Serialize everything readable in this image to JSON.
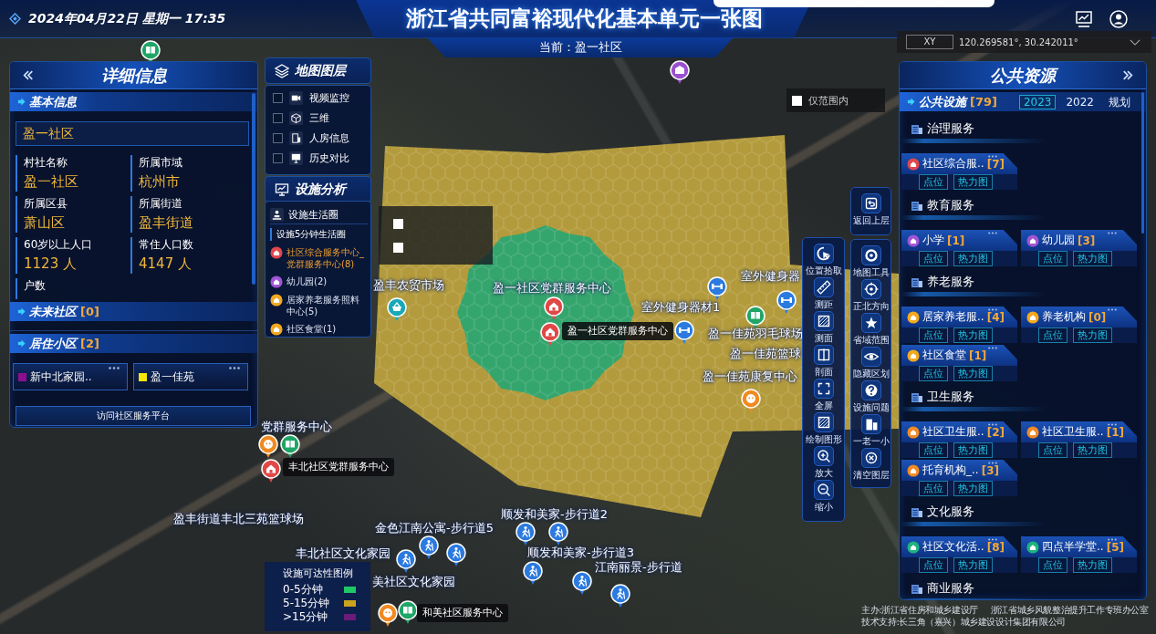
{
  "header": {
    "date": "2024年04月22日 星期一 17:35",
    "title": "浙江省共同富裕现代化基本单元一张图",
    "current": "当前：盈一社区"
  },
  "coordinates": {
    "label": "XY",
    "value": "120.269581°, 30.242011°"
  },
  "map": {
    "zones": [
      {
        "color": "#b39b3d"
      },
      {
        "color": "#35a56e"
      }
    ],
    "markers": [
      {
        "kind": "culture"
      },
      {
        "kind": "school"
      },
      {
        "kind": "market"
      },
      {
        "kind": "party"
      },
      {
        "kind": "party"
      },
      {
        "kind": "fitness"
      },
      {
        "kind": "fitness"
      },
      {
        "kind": "fitness"
      },
      {
        "kind": "culture"
      },
      {
        "kind": "elderly"
      },
      {
        "kind": "elderly"
      },
      {
        "kind": "culture"
      },
      {
        "kind": "party"
      },
      {
        "kind": "walkway"
      },
      {
        "kind": "walkway"
      },
      {
        "kind": "walkway"
      },
      {
        "kind": "walkway"
      },
      {
        "kind": "walkway"
      },
      {
        "kind": "walkway"
      },
      {
        "kind": "walkway"
      },
      {
        "kind": "walkway"
      },
      {
        "kind": "elderly"
      },
      {
        "kind": "culture"
      }
    ],
    "labels": [
      {
        "text": "盈丰农贸市场",
        "kind": "plain"
      },
      {
        "text": "盈一社区党群服务中心",
        "kind": "plain"
      },
      {
        "text": "室外健身器",
        "kind": "plain"
      },
      {
        "text": "室外健身器材1",
        "kind": "plain"
      },
      {
        "text": "盈一社区党群服务中心",
        "kind": "boxed"
      },
      {
        "text": "盈一佳苑羽毛球场",
        "kind": "plain"
      },
      {
        "text": "盈一佳苑篮球",
        "kind": "plain"
      },
      {
        "text": "盈一佳苑康复中心",
        "kind": "plain"
      },
      {
        "text": "党群服务中心",
        "kind": "plain"
      },
      {
        "text": "丰北社区党群服务中心",
        "kind": "boxed"
      },
      {
        "text": "盈丰街道丰北三苑篮球场",
        "kind": "plain"
      },
      {
        "text": "金色江南公寓-步行道5",
        "kind": "plain"
      },
      {
        "text": "顺发和美家-步行道2",
        "kind": "plain"
      },
      {
        "text": "丰北社区文化家园",
        "kind": "plain"
      },
      {
        "text": "顺发和美家-步行道3",
        "kind": "plain"
      },
      {
        "text": "江南丽景-步行道",
        "kind": "plain"
      },
      {
        "text": "美社区文化家园",
        "kind": "plain"
      },
      {
        "text": "和美社区服务中心",
        "kind": "boxed"
      }
    ],
    "toggles": [
      {
        "checked": false
      },
      {
        "checked": false
      }
    ],
    "range_filter": {
      "label": "仅范围内",
      "checked": false
    }
  },
  "detail_panel": {
    "title": "详细信息",
    "basic_info": {
      "heading": "基本信息",
      "name_field": "盈一社区",
      "fields": [
        {
          "label": "村社名称",
          "value": "盈一社区"
        },
        {
          "label": "所属市域",
          "value": "杭州市"
        },
        {
          "label": "所属区县",
          "value": "萧山区"
        },
        {
          "label": "所属街道",
          "value": "盈丰街道"
        },
        {
          "label": "60岁以上人口",
          "value": "1123 人"
        },
        {
          "label": "常住人口数",
          "value": "4147 人"
        },
        {
          "label": "户数"
        }
      ]
    },
    "future_community": {
      "heading": "未来社区",
      "count": "[0]"
    },
    "residential": {
      "heading": "居住小区",
      "count": "[2]",
      "items": [
        {
          "name": "新中北家园..",
          "color": "#8e0f8e"
        },
        {
          "name": "盈一佳苑",
          "color": "#f5e60a"
        }
      ]
    },
    "platform_button": "访问社区服务平台"
  },
  "layer_panel": {
    "title": "地图图层",
    "layers": [
      {
        "label": "视频监控",
        "checked": false
      },
      {
        "label": "三维",
        "checked": false
      },
      {
        "label": "人房信息",
        "checked": false
      },
      {
        "label": "历史对比",
        "checked": false
      }
    ]
  },
  "analysis_panel": {
    "title": "设施分析",
    "mode": "设施生活圈",
    "subtitle": "设施5分钟生活圈",
    "items": [
      {
        "label": "社区综合服务中心_党群服务中心(8)",
        "color": "#e0474c",
        "selected": true
      },
      {
        "label": "幼儿园(2)",
        "color": "#a055d6",
        "selected": false
      },
      {
        "label": "居家养老服务照料中心(5)",
        "color": "#f2a91e",
        "selected": false
      },
      {
        "label": "社区食堂(1)",
        "color": "#f2a91e",
        "selected": false
      }
    ]
  },
  "tools": {
    "back": "返回上层",
    "column_1": [
      "位置拾取",
      "测距",
      "测面",
      "剖面",
      "全屏",
      "绘制图形",
      "放大",
      "缩小"
    ],
    "column_2": [
      "地图工具",
      "正北方向",
      "省域范围",
      "隐藏区划",
      "设施问题",
      "一老一小",
      "清空图层"
    ]
  },
  "legend": {
    "title": "设施可达性图例",
    "items": [
      {
        "label": "0-5分钟",
        "color": "#1ec864"
      },
      {
        "label": "5-15分钟",
        "color": "#c9a21e"
      },
      {
        "label": ">15分钟",
        "color": "#6b1b7a"
      }
    ]
  },
  "resources_panel": {
    "title": "公共资源",
    "section": {
      "heading": "公共设施",
      "count": "[79]",
      "tabs": [
        {
          "label": "2023",
          "selected": true
        },
        {
          "label": "2022",
          "selected": false
        },
        {
          "label": "规划",
          "selected": false
        }
      ]
    },
    "categories": [
      {
        "name": "治理服务",
        "facilities": [
          {
            "name": "社区综合服..",
            "count": "[7]",
            "color": "#e0474c",
            "actions": [
              "点位",
              "热力图"
            ]
          }
        ]
      },
      {
        "name": "教育服务",
        "facilities": [
          {
            "name": "小学",
            "count": "[1]",
            "color": "#a055d6",
            "actions": [
              "点位",
              "热力图"
            ]
          },
          {
            "name": "幼儿园",
            "count": "[3]",
            "color": "#a055d6",
            "actions": [
              "点位",
              "热力图"
            ]
          }
        ]
      },
      {
        "name": "养老服务",
        "facilities": [
          {
            "name": "居家养老服..",
            "count": "[4]",
            "color": "#f2a91e",
            "actions": [
              "点位",
              "热力图"
            ]
          },
          {
            "name": "养老机构",
            "count": "[0]",
            "color": "#f2a91e",
            "actions": [
              "点位",
              "热力图"
            ]
          },
          {
            "name": "社区食堂",
            "count": "[1]",
            "color": "#f2a91e",
            "actions": [
              "点位",
              "热力图"
            ]
          }
        ]
      },
      {
        "name": "卫生服务",
        "facilities": [
          {
            "name": "社区卫生服..",
            "count": "[2]",
            "color": "#f08a24",
            "actions": [
              "点位",
              "热力图"
            ]
          },
          {
            "name": "社区卫生服..",
            "count": "[1]",
            "color": "#f08a24",
            "actions": [
              "点位",
              "热力图"
            ]
          },
          {
            "name": "托育机构_..",
            "count": "[3]",
            "color": "#f08a24",
            "actions": [
              "点位",
              "热力图"
            ]
          }
        ]
      },
      {
        "name": "文化服务",
        "facilities": [
          {
            "name": "社区文化活..",
            "count": "[8]",
            "color": "#1fb47e",
            "actions": [
              "点位",
              "热力图"
            ]
          },
          {
            "name": "四点半学堂..",
            "count": "[5]",
            "color": "#1fb47e",
            "actions": [
              "点位",
              "热力图"
            ]
          }
        ]
      },
      {
        "name": "商业服务"
      }
    ]
  },
  "footer": {
    "sponsors": [
      "主办:浙江省住房和城乡建设厅",
      "浙江省城乡风貌整治提升工作专班办公室"
    ],
    "support": "技术支持:长三角（嘉兴）城乡建设设计集团有限公司"
  }
}
